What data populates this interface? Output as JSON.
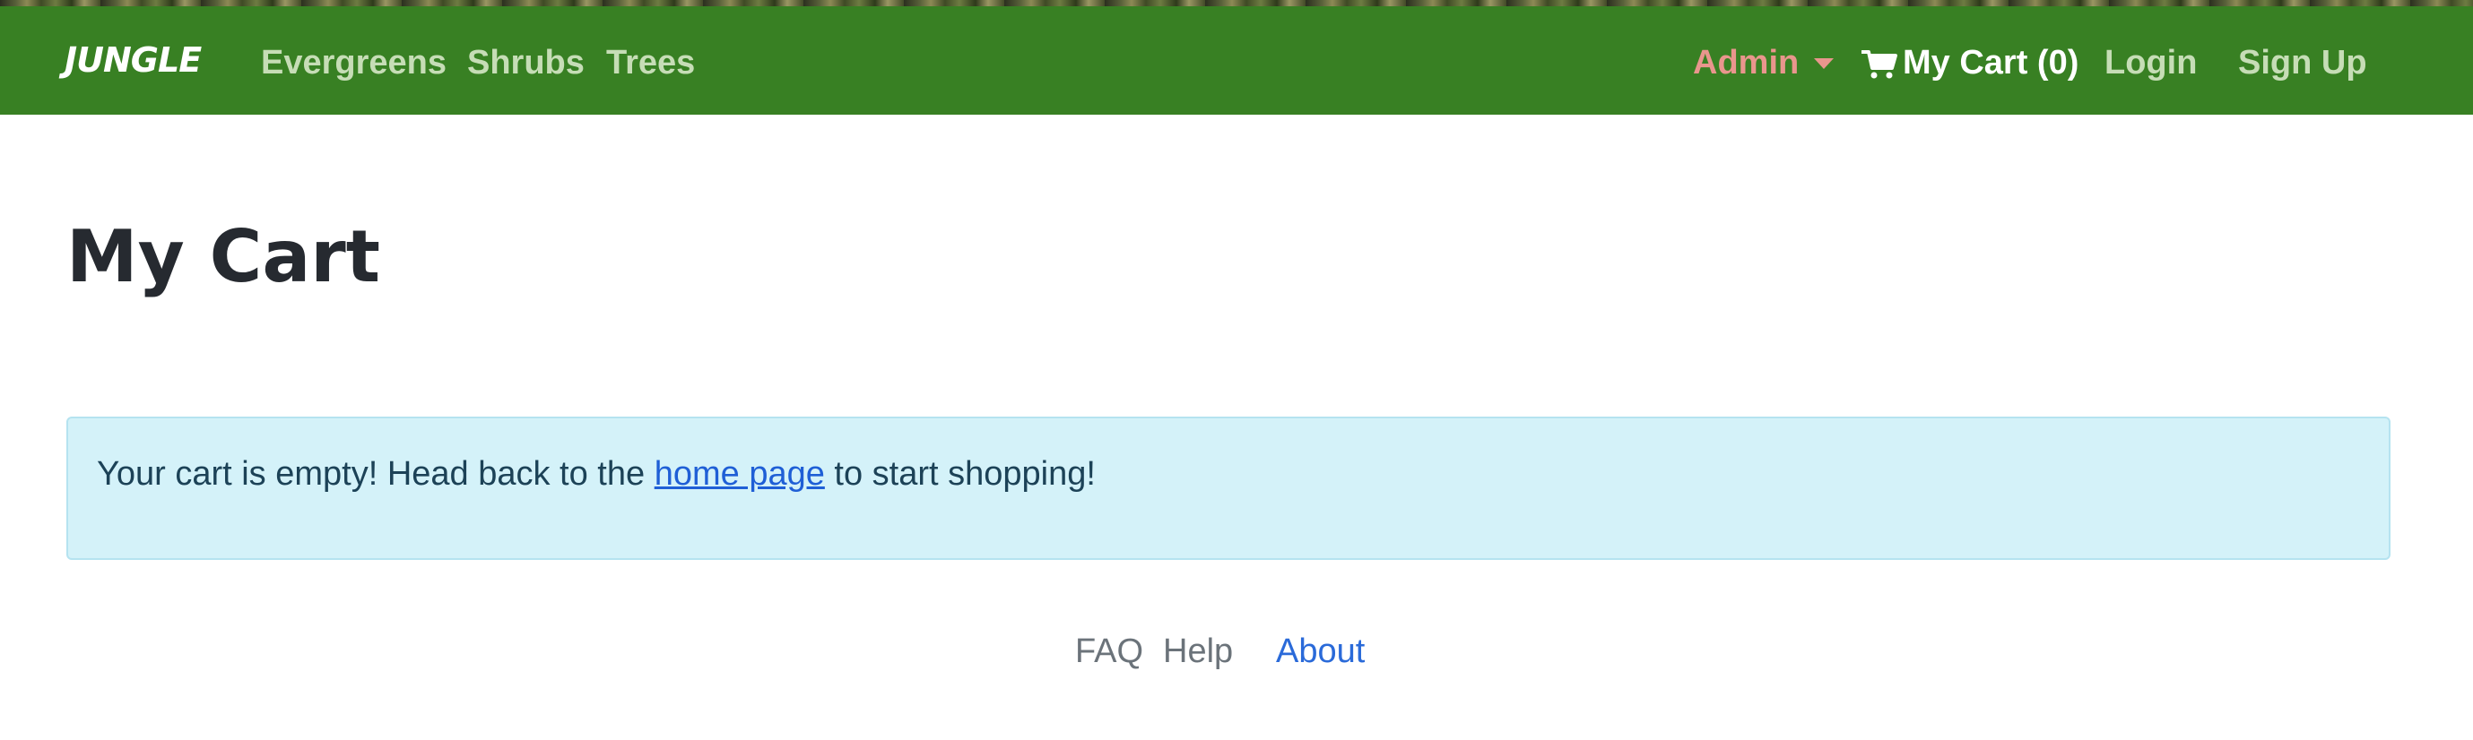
{
  "navbar": {
    "brand": "JUNGLE",
    "links": {
      "evergreens": "Evergreens",
      "shrubs": "Shrubs",
      "trees": "Trees"
    },
    "admin_label": "Admin",
    "cart_label": "My Cart (0)",
    "login_label": "Login",
    "signup_label": "Sign Up",
    "colors": {
      "background": "#388023",
      "link": "#c6ddb6",
      "admin": "#e9968d",
      "cart": "#ffffff"
    }
  },
  "main": {
    "title": "My Cart",
    "alert": {
      "before": "Your cart is empty! Head back to the ",
      "link": "home page",
      "after": " to start shopping!",
      "background": "#d4f2f9"
    }
  },
  "footer": {
    "faq": "FAQ",
    "help": "Help",
    "about": "About"
  },
  "icons": {
    "cart": "shopping-cart-icon",
    "caret": "caret-down-icon"
  }
}
